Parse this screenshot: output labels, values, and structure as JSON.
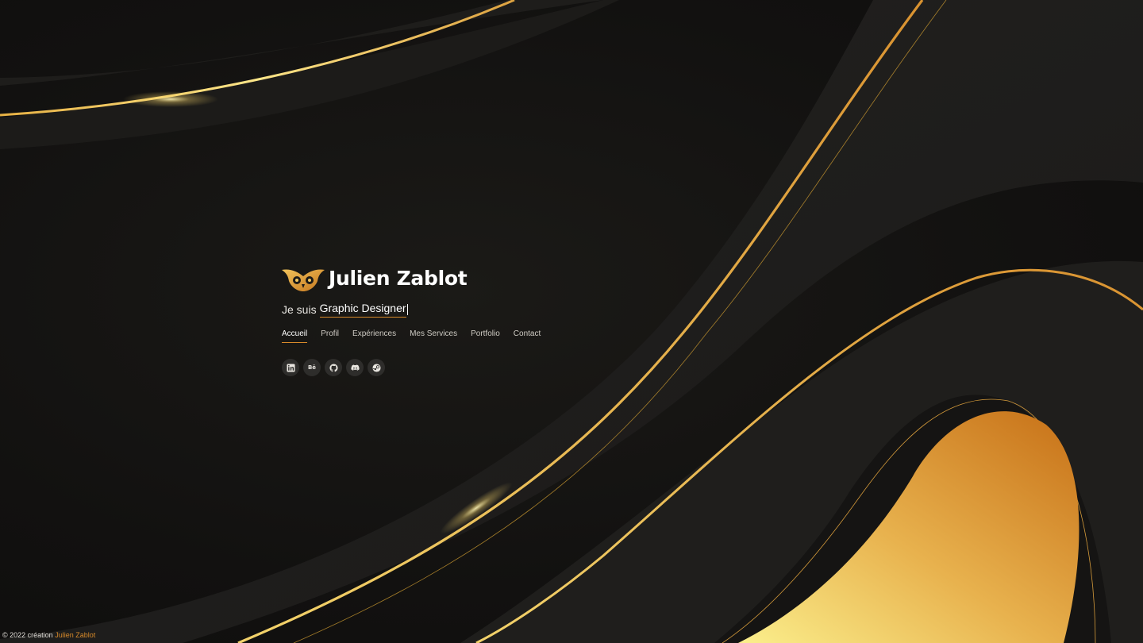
{
  "brand": {
    "name": "Julien Zablot",
    "logo_icon": "owl-icon"
  },
  "hero": {
    "intro": "Je suis",
    "role": "Graphic Designer"
  },
  "nav": {
    "items": [
      {
        "label": "Accueil",
        "active": true
      },
      {
        "label": "Profil",
        "active": false
      },
      {
        "label": "Expériences",
        "active": false
      },
      {
        "label": "Mes Services",
        "active": false
      },
      {
        "label": "Portfolio",
        "active": false
      },
      {
        "label": "Contact",
        "active": false
      }
    ]
  },
  "social": {
    "linkedin": "in",
    "behance": "Bē",
    "icons": [
      "linkedin-icon",
      "behance-icon",
      "github-icon",
      "discord-icon",
      "steam-icon"
    ]
  },
  "footer": {
    "prefix": "© 2022 création",
    "author": "Julien Zablot"
  },
  "colors": {
    "accent": "#d88a2a",
    "gold_light": "#f7e27a",
    "background": "#121110",
    "text": "#ffffff"
  }
}
